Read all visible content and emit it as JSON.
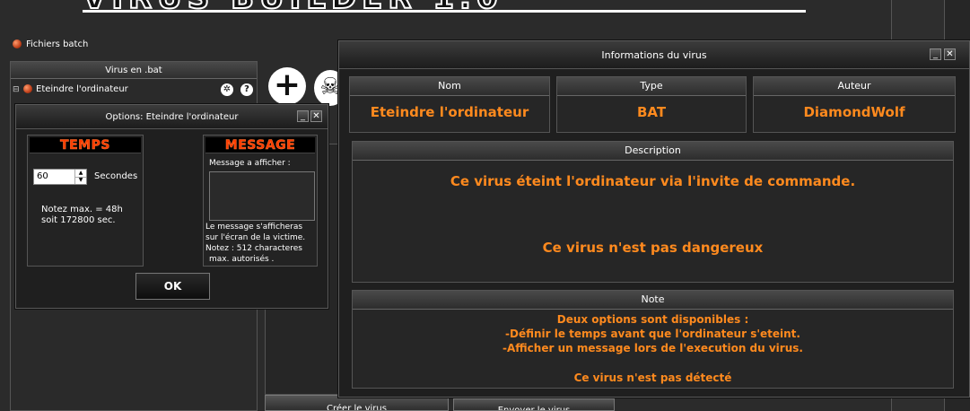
{
  "app": {
    "batch_label": "Fichiers batch",
    "list_header": "Virus en .bat",
    "list_item": "Eteindre l'ordinateur",
    "list_item_expander": "⊟",
    "settings_glyph": "✲",
    "help_glyph": "?",
    "plus_glyph": "+",
    "skull_glyph": "☠",
    "bottom_button_1": "Créer le virus",
    "bottom_button_2": "Envoyer le virus"
  },
  "info_window": {
    "title": "Informations du virus",
    "minimize": "_",
    "close": "✕",
    "nom_header": "Nom",
    "nom_value": "Eteindre l'ordinateur",
    "type_header": "Type",
    "type_value": "BAT",
    "auteur_header": "Auteur",
    "auteur_value": "DiamondWolf",
    "description_header": "Description",
    "description_line1": "Ce virus éteint l'ordinateur via l'invite de commande.",
    "description_line2": "Ce virus n'est pas dangereux",
    "note_header": "Note",
    "note_line1": "Deux options sont disponibles :",
    "note_line2": "-Définir le temps avant que l'ordinateur s'eteint.",
    "note_line3": "-Afficher un message lors de l'execution du virus.",
    "note_line4": "Ce virus n'est pas détecté"
  },
  "options_window": {
    "title": "Options: Eteindre l'ordinateur",
    "minimize": "_",
    "close": "✕",
    "temps_header": "TEMPS",
    "seconds_value": "60",
    "seconds_label": "Secondes",
    "note_line1": "Notez max. = 48h",
    "note_line2": "soit 172800 sec.",
    "message_header": "MESSAGE",
    "message_prompt": "Message a afficher :",
    "message_value": "",
    "message_note1": "Le message s'afficheras",
    "message_note2": "sur l'écran de la victime.",
    "message_note3": "Notez : 512 characteres",
    "message_note4": "max. autorisés .",
    "ok_label": "OK"
  },
  "colors": {
    "accent_orange": "#ff8a1e",
    "header_red": "#ff3c00"
  }
}
